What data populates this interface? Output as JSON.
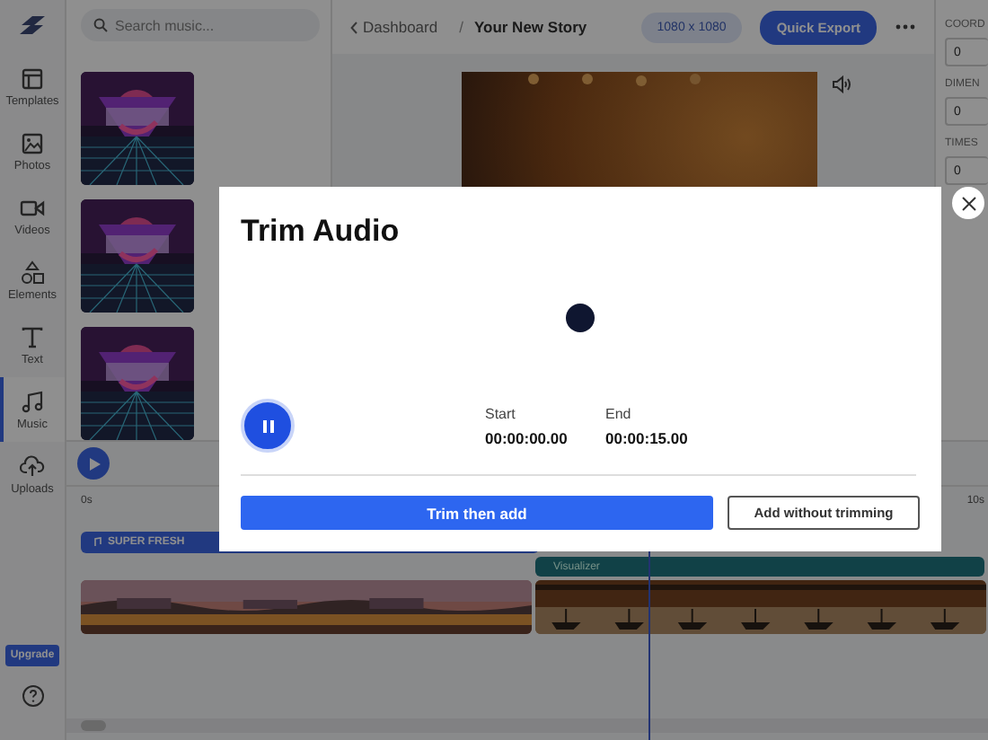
{
  "sidebar": {
    "items": [
      {
        "label": "Templates",
        "selected": false
      },
      {
        "label": "Photos",
        "selected": false
      },
      {
        "label": "Videos",
        "selected": false
      },
      {
        "label": "Elements",
        "selected": false
      },
      {
        "label": "Text",
        "selected": false
      },
      {
        "label": "Music",
        "selected": true
      },
      {
        "label": "Uploads",
        "selected": false
      }
    ],
    "upgrade": "Upgrade"
  },
  "music_panel": {
    "search": {
      "placeholder": "Search music..."
    }
  },
  "top_bar": {
    "back": "Dashboard",
    "separator": "/",
    "title": "Your New Story",
    "size": "1080 x 1080",
    "export": "Quick Export"
  },
  "properties": {
    "fields": [
      {
        "label": "COORD",
        "value": "0"
      },
      {
        "label": "DIMEN",
        "value": "0"
      },
      {
        "label": "TIMES",
        "value": "0"
      }
    ]
  },
  "timeline": {
    "ticks": [
      "0s",
      "10s"
    ],
    "audio_track": "SUPER FRESH",
    "visualizer": "Visualizer"
  },
  "dialog": {
    "title": "Trim Audio",
    "playing": true,
    "start_label": "Start",
    "start": "00:00:00.00",
    "end_label": "End",
    "end": "00:00:15.00",
    "buttons": [
      {
        "label": "Trim then add",
        "kind": "primary"
      },
      {
        "label": "Add without trimming",
        "kind": "secondary"
      }
    ]
  }
}
